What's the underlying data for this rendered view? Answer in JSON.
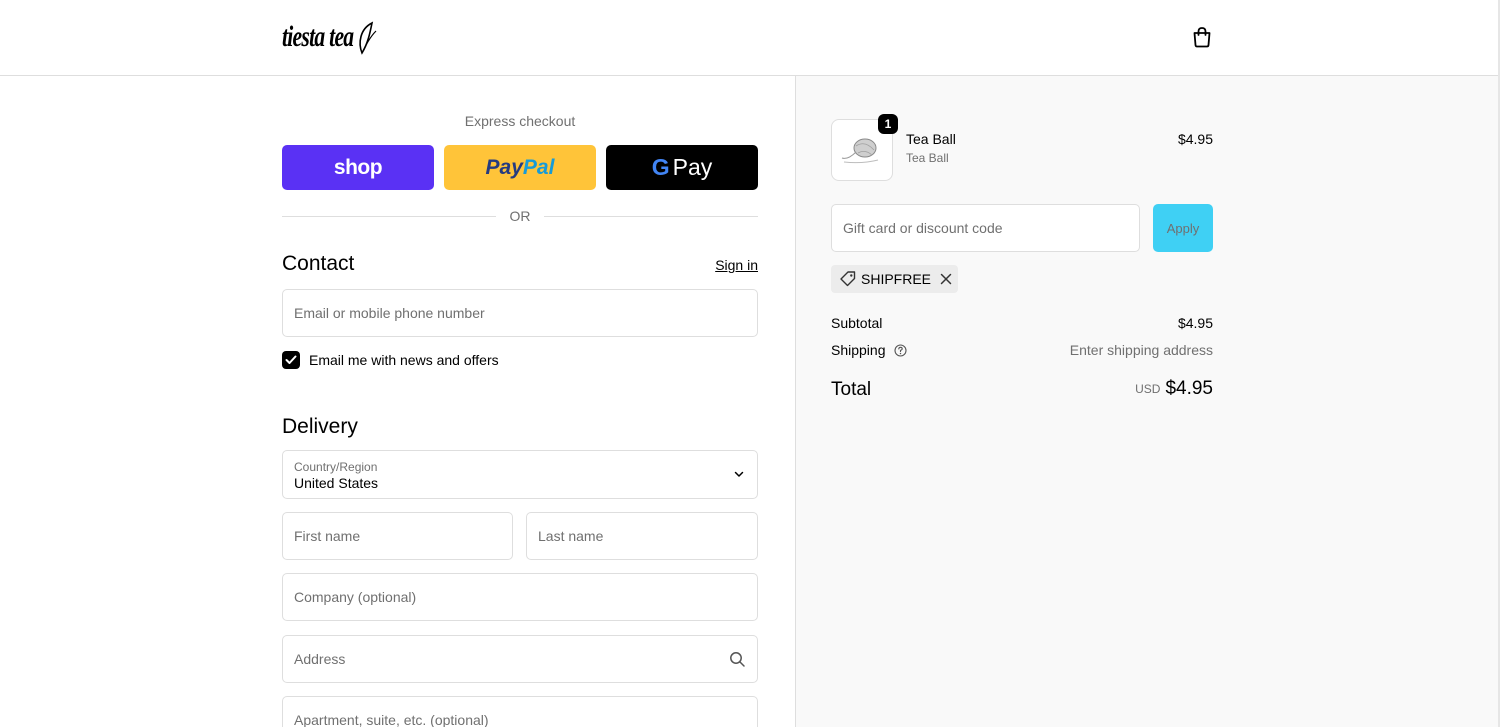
{
  "header": {
    "logo_text": "tiesta tea",
    "cart_icon": "shopping-bag-icon"
  },
  "express": {
    "label": "Express checkout",
    "shop_label": "shop",
    "paypal_part1": "Pay",
    "paypal_part2": "Pal",
    "gpay_g": "G",
    "gpay_label": "Pay",
    "or_label": "OR"
  },
  "contact": {
    "title": "Contact",
    "sign_in": "Sign in",
    "email_placeholder": "Email or mobile phone number",
    "news_label": "Email me with news and offers",
    "news_checked": true
  },
  "delivery": {
    "title": "Delivery",
    "country_label": "Country/Region",
    "country_value": "United States",
    "first_name_placeholder": "First name",
    "last_name_placeholder": "Last name",
    "company_placeholder": "Company (optional)",
    "address_placeholder": "Address",
    "apartment_placeholder": "Apartment, suite, etc. (optional)"
  },
  "summary": {
    "item": {
      "quantity": "1",
      "name": "Tea Ball",
      "variant": "Tea Ball",
      "price": "$4.95"
    },
    "discount_placeholder": "Gift card or discount code",
    "apply_label": "Apply",
    "discount_code": "SHIPFREE",
    "subtotal_label": "Subtotal",
    "subtotal_value": "$4.95",
    "shipping_label": "Shipping",
    "shipping_value": "Enter shipping address",
    "total_label": "Total",
    "total_currency": "USD",
    "total_value": "$4.95"
  },
  "colors": {
    "shop": "#5a31f4",
    "paypal": "#ffc439",
    "gpay": "#000000",
    "apply": "#3fd0f4"
  }
}
